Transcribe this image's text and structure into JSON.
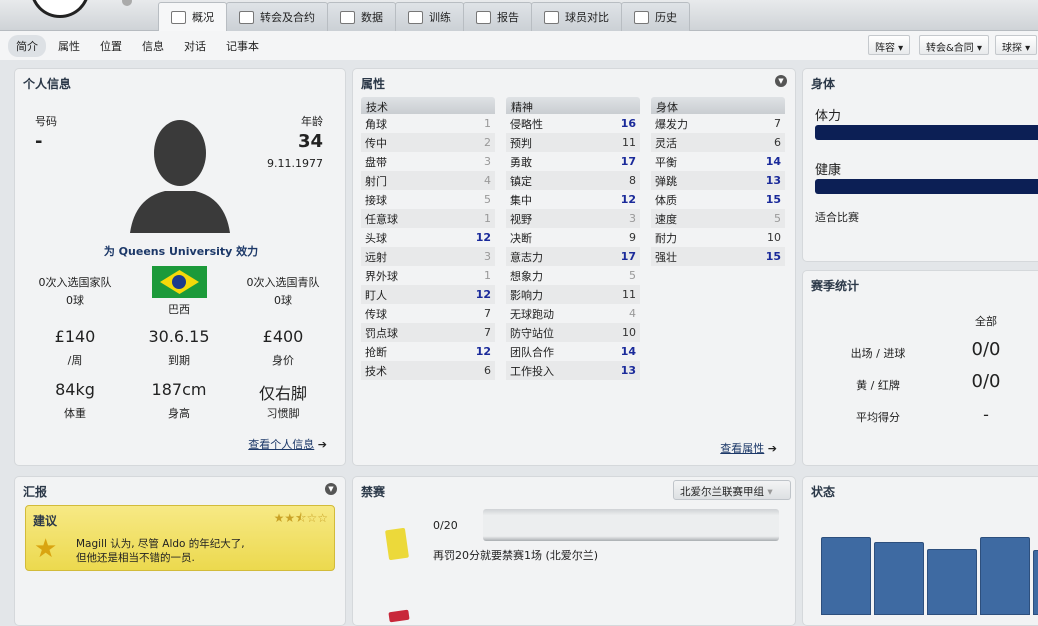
{
  "tabs": [
    {
      "label": "概况",
      "icon": "profile-card-icon"
    },
    {
      "label": "转会及合约",
      "icon": "document-icon"
    },
    {
      "label": "数据",
      "icon": "bar-chart-icon"
    },
    {
      "label": "训练",
      "icon": "cap-icon"
    },
    {
      "label": "报告",
      "icon": "report-icon"
    },
    {
      "label": "球员对比",
      "icon": "compare-icon"
    },
    {
      "label": "历史",
      "icon": "scroll-icon"
    }
  ],
  "subnav": [
    "简介",
    "属性",
    "位置",
    "信息",
    "对话",
    "记事本"
  ],
  "dropdowns": [
    "阵容",
    "转会&合同",
    "球探"
  ],
  "personal": {
    "title": "个人信息",
    "number_label": "号码",
    "number": "-",
    "age_label": "年龄",
    "age": "34",
    "dob": "9.11.1977",
    "plays_for": "为 Queens University 效力",
    "intl_caps": "0次入选国家队",
    "intl_goals": "0球",
    "youth_caps": "0次入选国青队",
    "youth_goals": "0球",
    "nation": "巴西",
    "wage": "£140",
    "wage_label": "/周",
    "expires": "30.6.15",
    "expires_label": "到期",
    "value": "£400",
    "value_label": "身价",
    "weight": "84kg",
    "weight_label": "体重",
    "height": "187cm",
    "height_label": "身高",
    "foot": "仅右脚",
    "foot_label": "习惯脚",
    "link": "查看个人信息"
  },
  "attributes": {
    "title": "属性",
    "link": "查看属性",
    "columns": [
      {
        "header": "技术",
        "items": [
          [
            "角球",
            1
          ],
          [
            "传中",
            2
          ],
          [
            "盘带",
            3
          ],
          [
            "射门",
            4
          ],
          [
            "接球",
            5
          ],
          [
            "任意球",
            1
          ],
          [
            "头球",
            12
          ],
          [
            "远射",
            3
          ],
          [
            "界外球",
            1
          ],
          [
            "盯人",
            12
          ],
          [
            "传球",
            7
          ],
          [
            "罚点球",
            7
          ],
          [
            "抢断",
            12
          ],
          [
            "技术",
            6
          ]
        ]
      },
      {
        "header": "精神",
        "items": [
          [
            "侵略性",
            16
          ],
          [
            "预判",
            11
          ],
          [
            "勇敢",
            17
          ],
          [
            "镇定",
            8
          ],
          [
            "集中",
            12
          ],
          [
            "视野",
            3
          ],
          [
            "决断",
            9
          ],
          [
            "意志力",
            17
          ],
          [
            "想象力",
            5
          ],
          [
            "影响力",
            11
          ],
          [
            "无球跑动",
            4
          ],
          [
            "防守站位",
            10
          ],
          [
            "团队合作",
            14
          ],
          [
            "工作投入",
            13
          ]
        ]
      },
      {
        "header": "身体",
        "items": [
          [
            "爆发力",
            7
          ],
          [
            "灵活",
            6
          ],
          [
            "平衡",
            14
          ],
          [
            "弹跳",
            13
          ],
          [
            "体质",
            15
          ],
          [
            "速度",
            5
          ],
          [
            "耐力",
            10
          ],
          [
            "强壮",
            15
          ]
        ]
      }
    ]
  },
  "physical": {
    "title": "身体",
    "condition_label": "体力",
    "condition": 100,
    "fitness_label": "健康",
    "fitness": 100,
    "status": "适合比赛"
  },
  "season": {
    "title": "赛季统计",
    "col": "全部",
    "rows": [
      [
        "出场 / 进球",
        "0/0"
      ],
      [
        "黄 / 红牌",
        "0/0"
      ],
      [
        "平均得分",
        "-"
      ]
    ]
  },
  "report": {
    "title": "汇报",
    "card_title": "建议",
    "stars": 2.5,
    "text1": "Magill 认为, 尽管 Aldo 的年纪大了,",
    "text2": "但他还是相当不错的一员."
  },
  "bans": {
    "title": "禁赛",
    "competition": "北爱尔兰联赛甲组",
    "points": "0/20",
    "progress": 0,
    "note": "再罚20分就要禁赛1场 (北爱尔兰)"
  },
  "form": {
    "title": "状态",
    "values": [
      100,
      93,
      84,
      100,
      83
    ]
  },
  "colors": {
    "accent": "#2b3848",
    "high": "#1a2a9a",
    "bar": "#0c1f55",
    "form": "#3e6aa2"
  }
}
